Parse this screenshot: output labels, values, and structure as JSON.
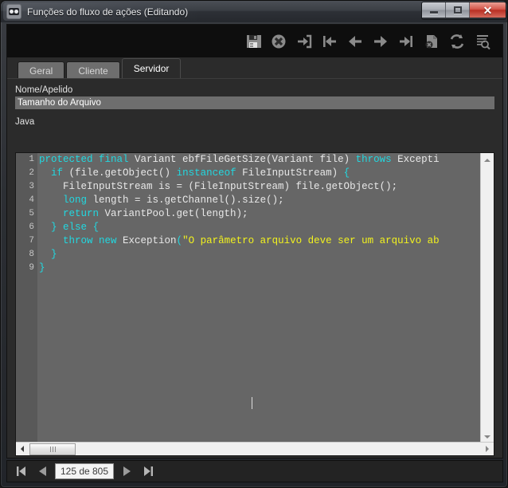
{
  "window": {
    "title": "Funções do fluxo de ações (Editando)",
    "app_icon": "goggles-icon",
    "minimize_label": "Minimizar",
    "maximize_label": "Maximizar",
    "close_label": "Fechar",
    "close_glyph": "✕"
  },
  "toolbar": {
    "buttons": [
      {
        "name": "save-button",
        "icon": "floppy-disk-icon",
        "label": "Salvar"
      },
      {
        "name": "cancel-button",
        "icon": "cancel-circle-icon",
        "label": "Cancelar"
      },
      {
        "name": "insert-record-button",
        "icon": "insert-arrow-icon",
        "label": "Inserir"
      },
      {
        "name": "first-record-button",
        "icon": "first-arrow-icon",
        "label": "Primeiro"
      },
      {
        "name": "previous-record-button",
        "icon": "left-arrow-icon",
        "label": "Anterior"
      },
      {
        "name": "next-record-button",
        "icon": "right-arrow-icon",
        "label": "Próximo"
      },
      {
        "name": "last-record-button",
        "icon": "last-arrow-icon",
        "label": "Último"
      },
      {
        "name": "delete-record-button",
        "icon": "delete-file-icon",
        "label": "Excluir"
      },
      {
        "name": "refresh-button",
        "icon": "refresh-icon",
        "label": "Atualizar"
      },
      {
        "name": "search-button",
        "icon": "search-list-icon",
        "label": "Pesquisar"
      }
    ]
  },
  "tabs": [
    {
      "label": "Geral",
      "active": false
    },
    {
      "label": "Cliente",
      "active": false
    },
    {
      "label": "Servidor",
      "active": true
    }
  ],
  "form": {
    "name_label": "Nome/Apelido",
    "name_value": "Tamanho do Arquivo",
    "name_placeholder": "",
    "code_label": "Java"
  },
  "editor": {
    "language": "Java",
    "lines": [
      {
        "n": "1",
        "tokens": [
          {
            "t": "protected final",
            "c": "kw"
          },
          {
            "t": " Variant ebfFileGetSize(Variant file) ",
            "c": ""
          },
          {
            "t": "throws",
            "c": "kw"
          },
          {
            "t": " Excepti",
            "c": ""
          }
        ]
      },
      {
        "n": "2",
        "tokens": [
          {
            "t": "  ",
            "c": ""
          },
          {
            "t": "if",
            "c": "kw"
          },
          {
            "t": " (file.getObject() ",
            "c": ""
          },
          {
            "t": "instanceof",
            "c": "kw"
          },
          {
            "t": " FileInputStream) ",
            "c": ""
          },
          {
            "t": "{",
            "c": "kw"
          }
        ]
      },
      {
        "n": "3",
        "tokens": [
          {
            "t": "    FileInputStream is = (FileInputStream) file.getObject();",
            "c": ""
          }
        ]
      },
      {
        "n": "4",
        "tokens": [
          {
            "t": "    ",
            "c": ""
          },
          {
            "t": "long",
            "c": "kw"
          },
          {
            "t": " length = is.getChannel().size();",
            "c": ""
          }
        ]
      },
      {
        "n": "5",
        "tokens": [
          {
            "t": "    ",
            "c": ""
          },
          {
            "t": "return",
            "c": "kw"
          },
          {
            "t": " VariantPool.get(length);",
            "c": ""
          }
        ]
      },
      {
        "n": "6",
        "tokens": [
          {
            "t": "  ",
            "c": ""
          },
          {
            "t": "}",
            "c": "kw"
          },
          {
            "t": " ",
            "c": ""
          },
          {
            "t": "else",
            "c": "kw"
          },
          {
            "t": " ",
            "c": ""
          },
          {
            "t": "{",
            "c": "kw"
          }
        ]
      },
      {
        "n": "7",
        "tokens": [
          {
            "t": "    ",
            "c": ""
          },
          {
            "t": "throw new",
            "c": "kw"
          },
          {
            "t": " Exception",
            "c": ""
          },
          {
            "t": "(",
            "c": "kw"
          },
          {
            "t": "\"O parâmetro arquivo deve ser um arquivo ab",
            "c": "str"
          }
        ]
      },
      {
        "n": "8",
        "tokens": [
          {
            "t": "  ",
            "c": ""
          },
          {
            "t": "}",
            "c": "kw"
          }
        ]
      },
      {
        "n": "9",
        "tokens": [
          {
            "t": "}",
            "c": "kw"
          }
        ]
      }
    ],
    "vscroll": {
      "up_icon": "scroll-up-arrow-icon",
      "down_icon": "scroll-down-arrow-icon"
    },
    "hscroll": {
      "left_icon": "scroll-left-arrow-icon",
      "right_icon": "scroll-right-arrow-icon"
    }
  },
  "navigator": {
    "first_icon": "nav-first-icon",
    "previous_icon": "nav-previous-icon",
    "counter": "125 de 805",
    "next_icon": "nav-next-icon",
    "last_icon": "nav-last-icon"
  },
  "colors": {
    "window_chrome": "#2c2f34",
    "client_bg": "#2b2b2b",
    "toolbar_bg": "#0e0e0e",
    "editor_bg": "#666666",
    "gutter_bg": "#595959",
    "keyword": "#22d8e0",
    "string": "#f2f21e",
    "text": "#e8e8e8",
    "close_button": "#b82f23"
  }
}
